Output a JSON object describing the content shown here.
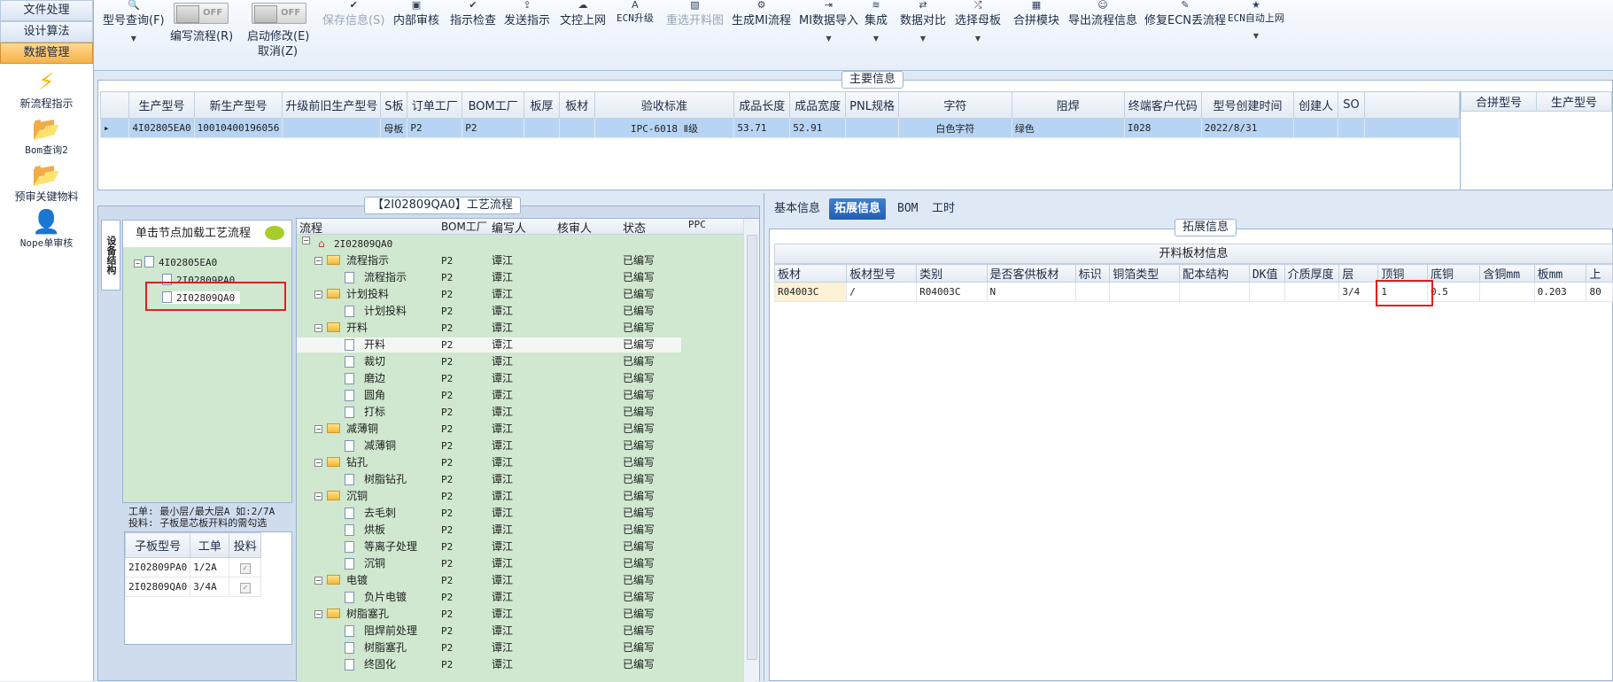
{
  "nav": {
    "buttons": [
      "文件处理",
      "设计算法",
      "数据管理"
    ],
    "items": [
      {
        "label": "新流程指示",
        "icon": "lightning-icon"
      },
      {
        "label": "Bom查询2",
        "icon": "folder-icon"
      },
      {
        "label": "预审关键物料",
        "icon": "folder-icon"
      },
      {
        "label": "Nope单审核",
        "icon": "user-icon"
      }
    ]
  },
  "ribbon": {
    "model_query": "型号查询(F)",
    "write_flow": "编写流程(R)",
    "start_modify": "启动修改(E)",
    "cancel": "取消(Z)",
    "toggle_off": "OFF",
    "save_info": "保存信息(S)",
    "items": [
      "内部审核",
      "指示检查",
      "发送指示",
      "文控上网",
      "ECN升级",
      "重选开料图",
      "生成MI流程",
      "MI数据导入",
      "集成",
      "数据对比",
      "选择母板",
      "合拼模块",
      "导出流程信息",
      "修复ECN丢流程",
      "ECN自动上网"
    ]
  },
  "main_info": {
    "title": "主要信息",
    "headers": [
      "生产型号",
      "新生产型号",
      "升级前旧生产型号",
      "S板",
      "订单工厂",
      "BOM工厂",
      "板厚",
      "板材",
      "验收标准",
      "成品长度",
      "成品宽度",
      "PNL规格",
      "字符",
      "阻焊",
      "终端客户代码",
      "型号创建时间",
      "创建人",
      "SO"
    ],
    "row": [
      "4I02805EA0",
      "10010400196056",
      "",
      "母板",
      "P2",
      "P2",
      "",
      "",
      "IPC-6018 Ⅱ级",
      "53.71",
      "52.91",
      "",
      "白色字符",
      "绿色",
      "I028",
      "2022/8/31",
      "",
      ""
    ],
    "right_headers": [
      "合拼型号",
      "生产型号"
    ]
  },
  "process": {
    "title": "【2I02809QA0】工艺流程",
    "side_tab": "设备结构",
    "hint": "单击节点加载工艺流程",
    "tree": [
      "4I02805EA0",
      "2I02809PA0",
      "2I02809QA0"
    ],
    "note1": "工单: 最小层/最大层A 如:2/7A",
    "note2": "投料: 子板是芯板开料的需勾选",
    "sub_headers": [
      "子板型号",
      "工单",
      "投料"
    ],
    "sub_rows": [
      [
        "2I02809PA0",
        "1/2A"
      ],
      [
        "2I02809QA0",
        "3/4A"
      ]
    ],
    "flow_headers": [
      "流程",
      "BOM工厂",
      "编写人",
      "核审人",
      "状态",
      "PPC"
    ],
    "root": "2I02809QA0",
    "factory": "P2",
    "writer": "谭江",
    "status": "已编写",
    "flow_rows": [
      {
        "name": "流程指示",
        "folder": true
      },
      {
        "name": "流程指示",
        "folder": false
      },
      {
        "name": "计划投料",
        "folder": true
      },
      {
        "name": "计划投料",
        "folder": false
      },
      {
        "name": "开料",
        "folder": true
      },
      {
        "name": "开料",
        "folder": false
      },
      {
        "name": "裁切",
        "folder": false
      },
      {
        "name": "磨边",
        "folder": false
      },
      {
        "name": "圆角",
        "folder": false
      },
      {
        "name": "打标",
        "folder": false
      },
      {
        "name": "减薄铜",
        "folder": true
      },
      {
        "name": "减薄铜",
        "folder": false
      },
      {
        "name": "钻孔",
        "folder": true
      },
      {
        "name": "树脂钻孔",
        "folder": false
      },
      {
        "name": "沉铜",
        "folder": true
      },
      {
        "name": "去毛刺",
        "folder": false
      },
      {
        "name": "烘板",
        "folder": false
      },
      {
        "name": "等离子处理",
        "folder": false
      },
      {
        "name": "沉铜",
        "folder": false
      },
      {
        "name": "电镀",
        "folder": true
      },
      {
        "name": "负片电镀",
        "folder": false
      },
      {
        "name": "树脂塞孔",
        "folder": true
      },
      {
        "name": "阻焊前处理",
        "folder": false
      },
      {
        "name": "树脂塞孔",
        "folder": false
      },
      {
        "name": "终固化",
        "folder": false
      }
    ]
  },
  "detail": {
    "tabs": [
      "基本信息",
      "拓展信息",
      "BOM",
      "工时"
    ],
    "section": "拓展信息",
    "grid_title": "开料板材信息",
    "headers": [
      "板材",
      "板材型号",
      "类别",
      "是否客供板材",
      "标识",
      "铜箔类型",
      "配本结构",
      "DK值",
      "介质厚度",
      "层",
      "顶铜",
      "底铜",
      "含铜mm",
      "板mm",
      "上"
    ],
    "row": [
      "R04003C",
      "/",
      "R04003C",
      "N",
      "",
      "",
      "",
      "",
      "",
      "3/4",
      "1",
      "0.5",
      "",
      "0.203",
      "80"
    ]
  }
}
